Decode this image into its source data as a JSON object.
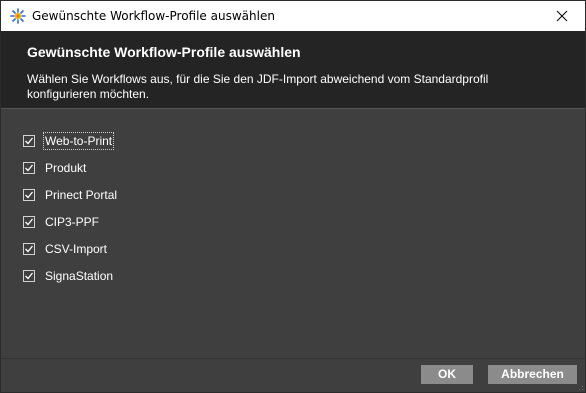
{
  "window": {
    "title": "Gewünschte Workflow-Profile auswählen"
  },
  "header": {
    "title": "Gewünschte Workflow-Profile auswählen",
    "description": "Wählen Sie Workflows aus, für die Sie den JDF-Import abweichend vom Standardprofil konfigurieren möchten."
  },
  "profiles": [
    {
      "label": "Web-to-Print",
      "checked": true,
      "focused": true
    },
    {
      "label": "Produkt",
      "checked": true,
      "focused": false
    },
    {
      "label": "Prinect Portal",
      "checked": true,
      "focused": false
    },
    {
      "label": "CIP3-PPF",
      "checked": true,
      "focused": false
    },
    {
      "label": "CSV-Import",
      "checked": true,
      "focused": false
    },
    {
      "label": "SignaStation",
      "checked": true,
      "focused": false
    }
  ],
  "buttons": {
    "ok": "OK",
    "cancel": "Abbrechen"
  },
  "icons": {
    "app": "prinect-app-icon",
    "close": "close-icon",
    "check": "checkmark-icon",
    "grip": "resize-grip-icon"
  },
  "colors": {
    "header_bg": "#242424",
    "body_bg": "#3f3f3f",
    "button_bg": "#8b8b8b",
    "text": "#ffffff"
  }
}
